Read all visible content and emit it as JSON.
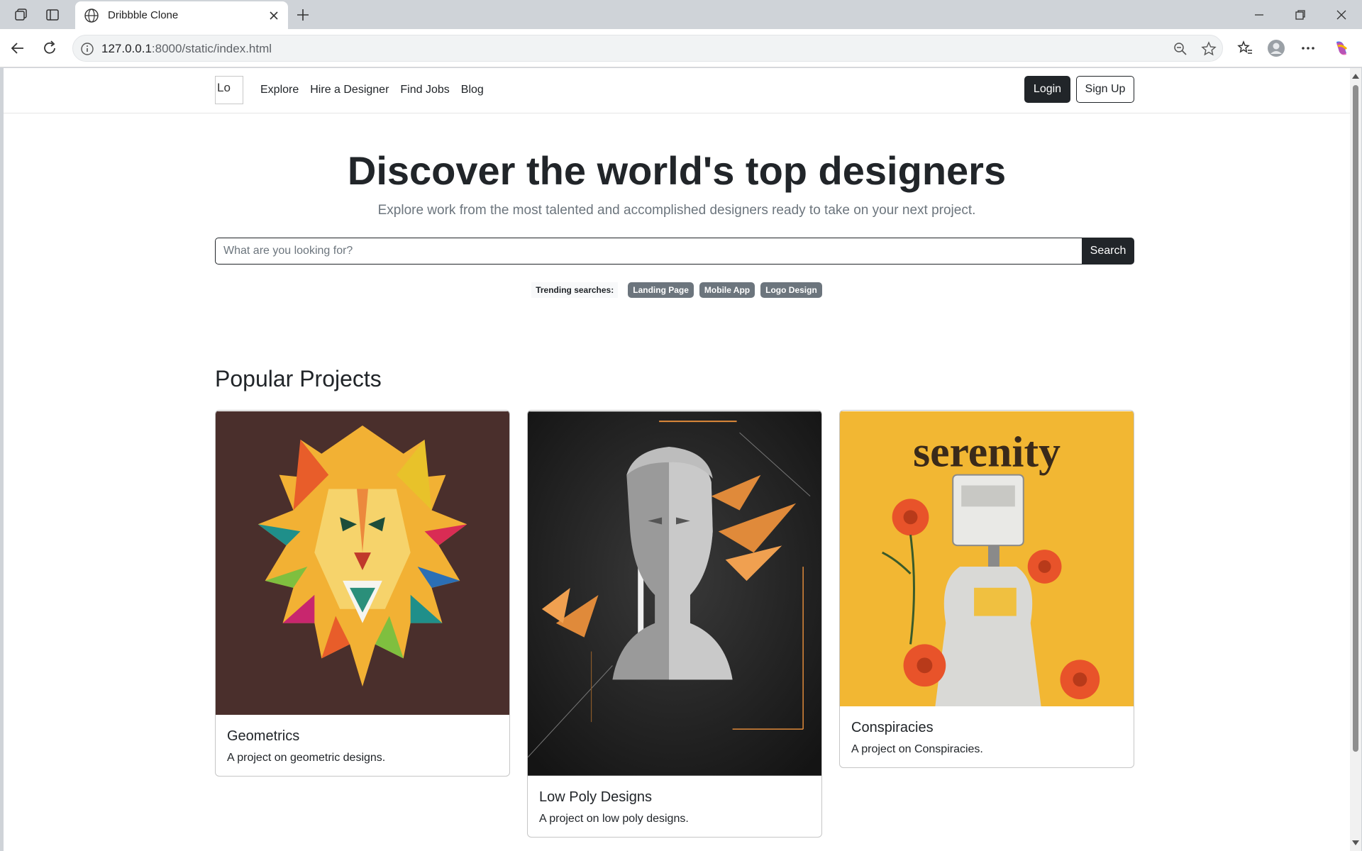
{
  "browser": {
    "tab_title": "Dribbble Clone",
    "url_host": "127.0.0.1",
    "url_rest": ":8000/static/index.html"
  },
  "navbar": {
    "logo_alt": "Lo",
    "links": [
      "Explore",
      "Hire a Designer",
      "Find Jobs",
      "Blog"
    ],
    "login_label": "Login",
    "signup_label": "Sign Up"
  },
  "hero": {
    "title": "Discover the world's top designers",
    "subtitle": "Explore work from the most talented and accomplished designers ready to take on your next project."
  },
  "search": {
    "placeholder": "What are you looking for?",
    "button_label": "Search"
  },
  "trending": {
    "label": "Trending searches:",
    "tags": [
      "Landing Page",
      "Mobile App",
      "Logo Design"
    ]
  },
  "projects": {
    "heading": "Popular Projects",
    "items": [
      {
        "title": "Geometrics",
        "description": "A project on geometric designs."
      },
      {
        "title": "Low Poly Designs",
        "description": "A project on low poly designs."
      },
      {
        "title": "Conspiracies",
        "description": "A project on Conspiracies.",
        "image_text": "serenity"
      }
    ]
  },
  "colors": {
    "primary_dark": "#212529",
    "muted": "#6c757d",
    "badge": "#6c757d"
  }
}
